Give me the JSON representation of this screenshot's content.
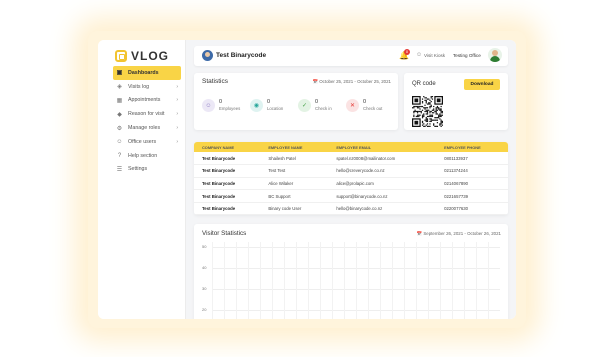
{
  "logo": {
    "text": "VLOG",
    "color": "#f2c430"
  },
  "sidebar": {
    "items": [
      {
        "label": "Dashboards",
        "icon": "dashboard-icon",
        "active": true,
        "chevron": false
      },
      {
        "label": "Visits log",
        "icon": "log-icon",
        "active": false,
        "chevron": true
      },
      {
        "label": "Appointments",
        "icon": "calendar-icon",
        "active": false,
        "chevron": true
      },
      {
        "label": "Reason for visit",
        "icon": "megaphone-icon",
        "active": false,
        "chevron": true
      },
      {
        "label": "Manage roles",
        "icon": "gear-icon",
        "active": false,
        "chevron": true
      },
      {
        "label": "Office users",
        "icon": "users-icon",
        "active": false,
        "chevron": true
      },
      {
        "label": "Help section",
        "icon": "help-icon",
        "active": false,
        "chevron": false
      },
      {
        "label": "Settings",
        "icon": "settings-icon",
        "active": false,
        "chevron": false
      }
    ]
  },
  "header": {
    "company": "Test Binarycode",
    "notification_count": "0",
    "user_name": "Visit Kiosk",
    "office": "Testing Office"
  },
  "statistics": {
    "title": "Statistics",
    "date_range": "October 25, 2021 - October 25, 2021",
    "items": [
      {
        "value": "0",
        "label": "Employees",
        "icon": "employees-icon",
        "color": "#8e7cc3",
        "bg": "#ece8f6"
      },
      {
        "value": "0",
        "label": "Location",
        "icon": "location-icon",
        "color": "#26a69a",
        "bg": "#dff3f1"
      },
      {
        "value": "0",
        "label": "Check in",
        "icon": "check-in-icon",
        "color": "#43a047",
        "bg": "#e3f3e4"
      },
      {
        "value": "0",
        "label": "Check out",
        "icon": "check-out-icon",
        "color": "#e53935",
        "bg": "#fbe3e3"
      }
    ]
  },
  "qr": {
    "title": "QR code",
    "download_label": "Download"
  },
  "employees_table": {
    "headers": [
      "COMPANY NAME",
      "EMPLOYEE NAME",
      "EMPLOYEE EMAIL",
      "EMPLOYEE PHONE"
    ],
    "rows": [
      [
        "Test Binarycode",
        "Shailesh Patel",
        "spatel.nz0008@mailinator.com",
        "0801133937"
      ],
      [
        "Test Binarycode",
        "Test Test",
        "hello@creverycode.co.nz",
        "0211374244"
      ],
      [
        "Test Binarycode",
        "Alice Wilaker",
        "alice@prolapic.com",
        "0214067890"
      ],
      [
        "Test Binarycode",
        "BC Support",
        "support@binarycode.co.nz",
        "0221657739"
      ],
      [
        "Test Binarycode",
        "Binary code User",
        "hello@binarycode.co.nz",
        "0220077630"
      ]
    ],
    "header_color": "#f9d446"
  },
  "visitor_statistics": {
    "title": "Visitor Statistics",
    "date_range": "September 26, 2021 - October 26, 2021",
    "y_ticks": [
      "50",
      "40",
      "30",
      "20"
    ]
  },
  "accent_color": "#f9d446"
}
